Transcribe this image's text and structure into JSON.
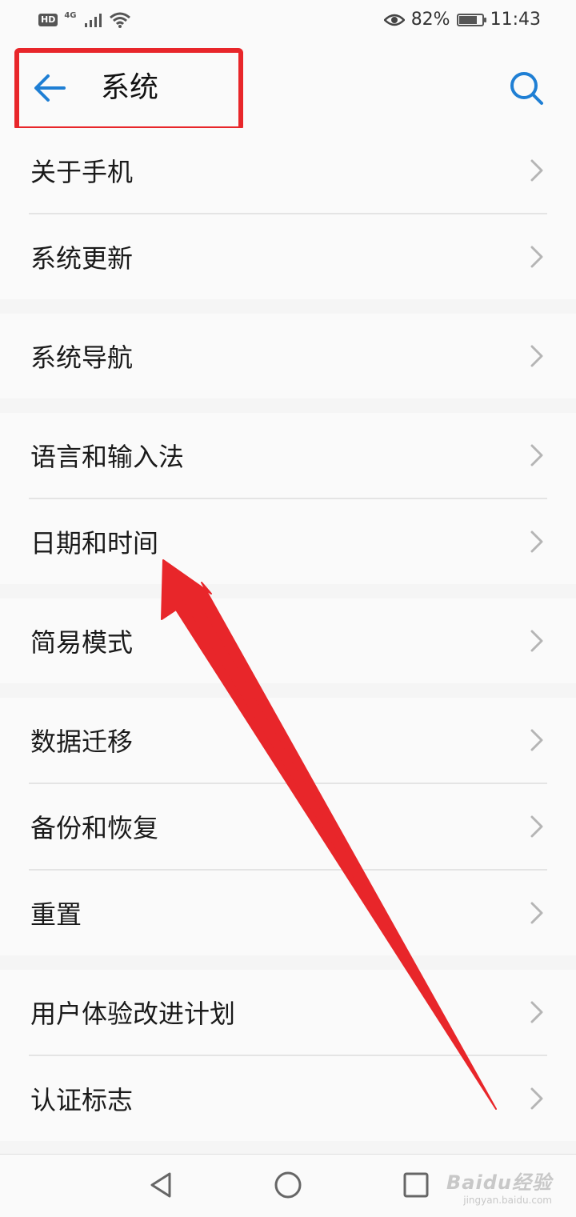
{
  "status_bar": {
    "hd": "HD",
    "network": "4G",
    "battery_percent": "82%",
    "time": "11:43",
    "icons": [
      "signal-icon",
      "wifi-icon",
      "eye-comfort-icon",
      "battery-icon"
    ]
  },
  "header": {
    "title": "系统",
    "back_icon": "back-arrow-icon",
    "search_icon": "search-icon",
    "accent_color": "#1f7fd4"
  },
  "list": {
    "groups": [
      {
        "items": [
          {
            "label": "关于手机"
          },
          {
            "label": "系统更新"
          }
        ]
      },
      {
        "items": [
          {
            "label": "系统导航"
          }
        ]
      },
      {
        "items": [
          {
            "label": "语言和输入法"
          },
          {
            "label": "日期和时间"
          }
        ]
      },
      {
        "items": [
          {
            "label": "简易模式"
          }
        ]
      },
      {
        "items": [
          {
            "label": "数据迁移"
          },
          {
            "label": "备份和恢复"
          },
          {
            "label": "重置"
          }
        ]
      },
      {
        "items": [
          {
            "label": "用户体验改进计划"
          },
          {
            "label": "认证标志"
          }
        ]
      }
    ],
    "chevron_icon": "chevron-right-icon"
  },
  "nav_bar": {
    "icons": [
      "nav-back-icon",
      "nav-home-icon",
      "nav-recents-icon"
    ]
  },
  "watermark": {
    "main": "Baidu经验",
    "sub": "jingyan.baidu.com"
  },
  "annotation": {
    "color": "#e8262a"
  }
}
